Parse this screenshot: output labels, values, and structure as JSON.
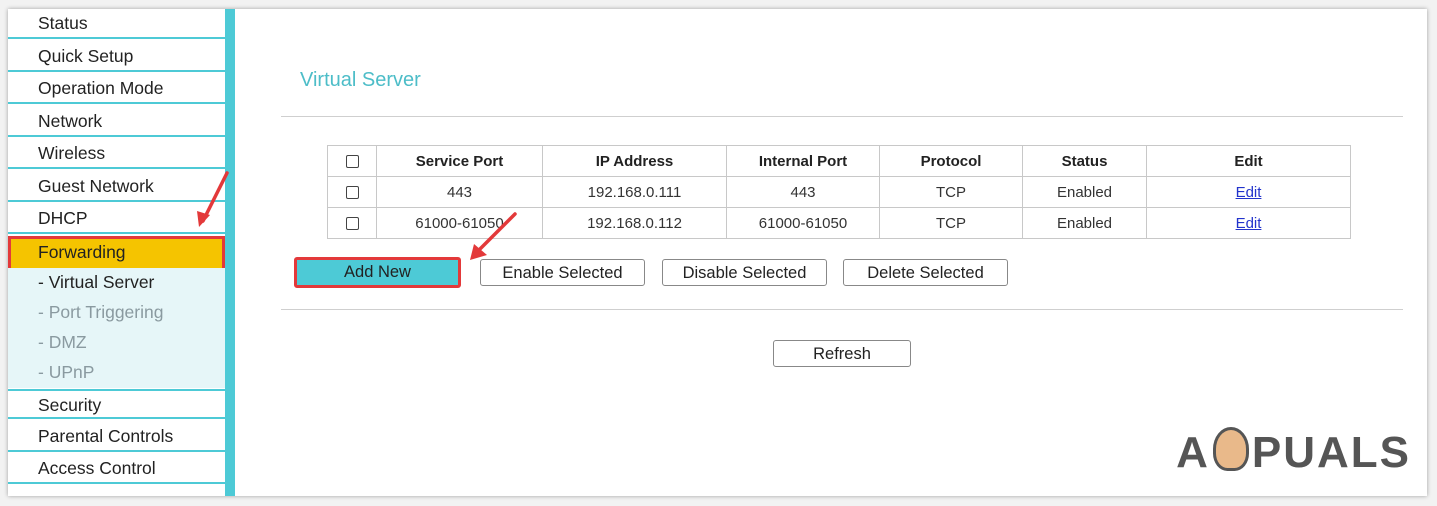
{
  "sidebar": {
    "items": [
      {
        "label": "Status"
      },
      {
        "label": "Quick Setup"
      },
      {
        "label": "Operation Mode"
      },
      {
        "label": "Network"
      },
      {
        "label": "Wireless"
      },
      {
        "label": "Guest Network"
      },
      {
        "label": "DHCP"
      },
      {
        "label": "Forwarding"
      },
      {
        "label": "Security"
      },
      {
        "label": "Parental Controls"
      },
      {
        "label": "Access Control"
      }
    ],
    "sub_items": [
      {
        "label": "- Virtual Server"
      },
      {
        "label": "- Port Triggering"
      },
      {
        "label": "- DMZ"
      },
      {
        "label": "- UPnP"
      }
    ]
  },
  "main": {
    "title": "Virtual Server",
    "table": {
      "headers": [
        "Service Port",
        "IP Address",
        "Internal Port",
        "Protocol",
        "Status",
        "Edit"
      ],
      "rows": [
        {
          "service_port": "443",
          "ip": "192.168.0.111",
          "internal_port": "443",
          "protocol": "TCP",
          "status": "Enabled",
          "edit": "Edit"
        },
        {
          "service_port": "61000-61050",
          "ip": "192.168.0.112",
          "internal_port": "61000-61050",
          "protocol": "TCP",
          "status": "Enabled",
          "edit": "Edit"
        }
      ]
    },
    "buttons": {
      "add_new": "Add New",
      "enable_selected": "Enable Selected",
      "disable_selected": "Disable Selected",
      "delete_selected": "Delete Selected",
      "refresh": "Refresh"
    }
  },
  "watermark": {
    "text_left": "A",
    "text_right": "PUALS"
  },
  "colors": {
    "accent": "#4dcad6",
    "highlight": "#f5c400",
    "annotation": "#e3393a",
    "link": "#2233cc"
  }
}
